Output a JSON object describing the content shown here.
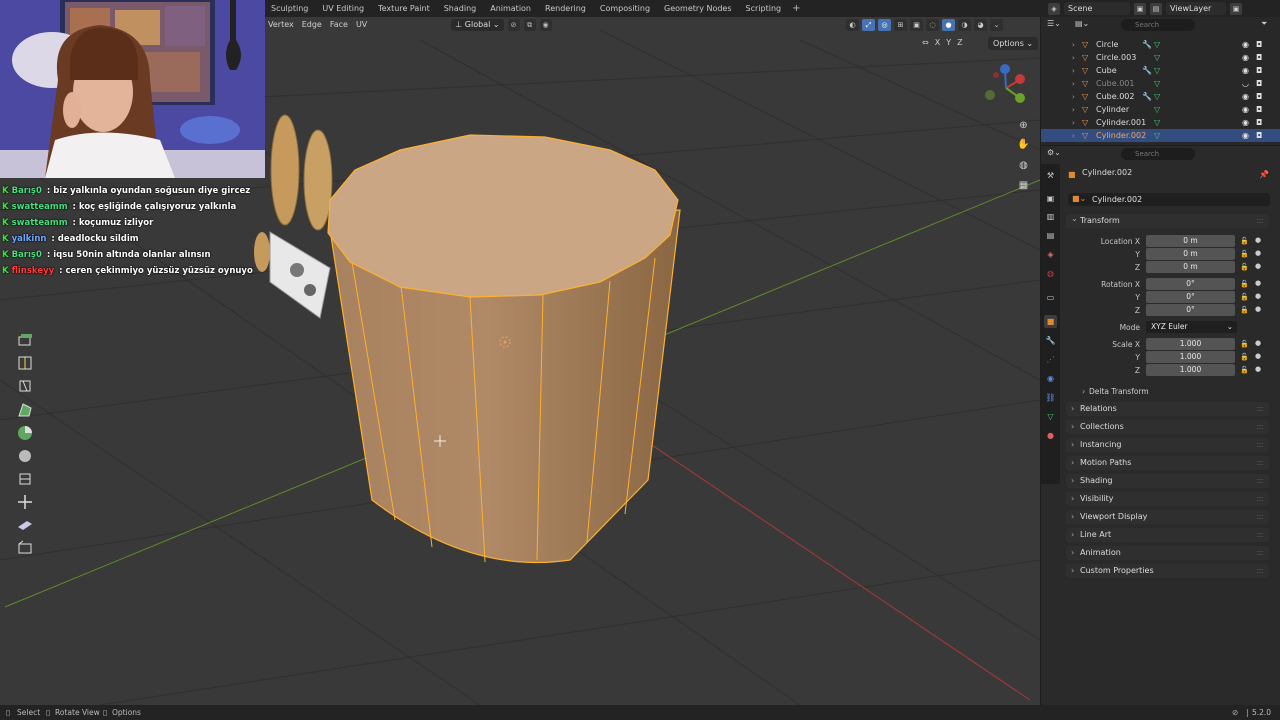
{
  "topbar": {
    "workspaces": [
      "Sculpting",
      "UV Editing",
      "Texture Paint",
      "Shading",
      "Animation",
      "Rendering",
      "Compositing",
      "Geometry Nodes",
      "Scripting"
    ],
    "add_symbol": "+",
    "scene": "Scene",
    "view_layer": "ViewLayer",
    "search_placeholder": "Search"
  },
  "viewport_header": {
    "menus": [
      "Vertex",
      "Edge",
      "Face",
      "UV"
    ],
    "orientation": "Global",
    "options_label": "Options",
    "axis_toggles": [
      "X",
      "Y",
      "Z"
    ]
  },
  "chat": [
    {
      "user": "Barış0",
      "message": " : biz yalkınla oyundan soğusun diye gircez",
      "user_color": "#4ade80"
    },
    {
      "user": "swatteamm",
      "message": " : koç eşliğinde çalışıyoruz yalkınla",
      "user_color": "#4ade80"
    },
    {
      "user": "swatteamm",
      "message": " : koçumuz izliyor",
      "user_color": "#4ade80"
    },
    {
      "user": "yalkinn",
      "message": " : deadlocku sildim",
      "user_color": "#6fa8ff"
    },
    {
      "user": "Barış0",
      "message": " : iqsu 50nin altında olanlar alınsın",
      "user_color": "#4ade80"
    },
    {
      "user": "flinskeyy",
      "message": " : ceren çekinmiyo yüzsüz yüzsüz oynuyo",
      "user_color": "#ff3b3b"
    }
  ],
  "outliner": {
    "items": [
      {
        "name": "Circle",
        "dim": false,
        "selected": false
      },
      {
        "name": "Circle.003",
        "dim": false,
        "selected": false
      },
      {
        "name": "Cube",
        "dim": false,
        "selected": false
      },
      {
        "name": "Cube.001",
        "dim": true,
        "selected": false
      },
      {
        "name": "Cube.002",
        "dim": false,
        "selected": false
      },
      {
        "name": "Cylinder",
        "dim": false,
        "selected": false
      },
      {
        "name": "Cylinder.001",
        "dim": false,
        "selected": false
      },
      {
        "name": "Cylinder.002",
        "dim": false,
        "selected": true
      }
    ]
  },
  "properties": {
    "search_placeholder": "Search",
    "object_title": "Cylinder.002",
    "object_name": "Cylinder.002",
    "transform_label": "Transform",
    "location_label": "Location X",
    "rotation_label": "Rotation X",
    "scale_label": "Scale X",
    "axis_y": "Y",
    "axis_z": "Z",
    "location": [
      "0 m",
      "0 m",
      "0 m"
    ],
    "rotation": [
      "0°",
      "0°",
      "0°"
    ],
    "scale": [
      "1.000",
      "1.000",
      "1.000"
    ],
    "mode_label": "Mode",
    "mode_value": "XYZ Euler",
    "delta_transform": "Delta Transform",
    "panels": [
      "Relations",
      "Collections",
      "Instancing",
      "Motion Paths",
      "Shading",
      "Visibility",
      "Viewport Display",
      "Line Art",
      "Animation",
      "Custom Properties"
    ]
  },
  "statusbar": {
    "select": "Select",
    "rotate_view": "Rotate View",
    "options": "Options",
    "version": "5.2.0"
  },
  "colors": {
    "selection": "#ffb02e",
    "mesh_face": "#c9a27c",
    "accent_blue": "#4772b3",
    "x_axis": "#c23a3a",
    "y_axis": "#6ba02a"
  }
}
